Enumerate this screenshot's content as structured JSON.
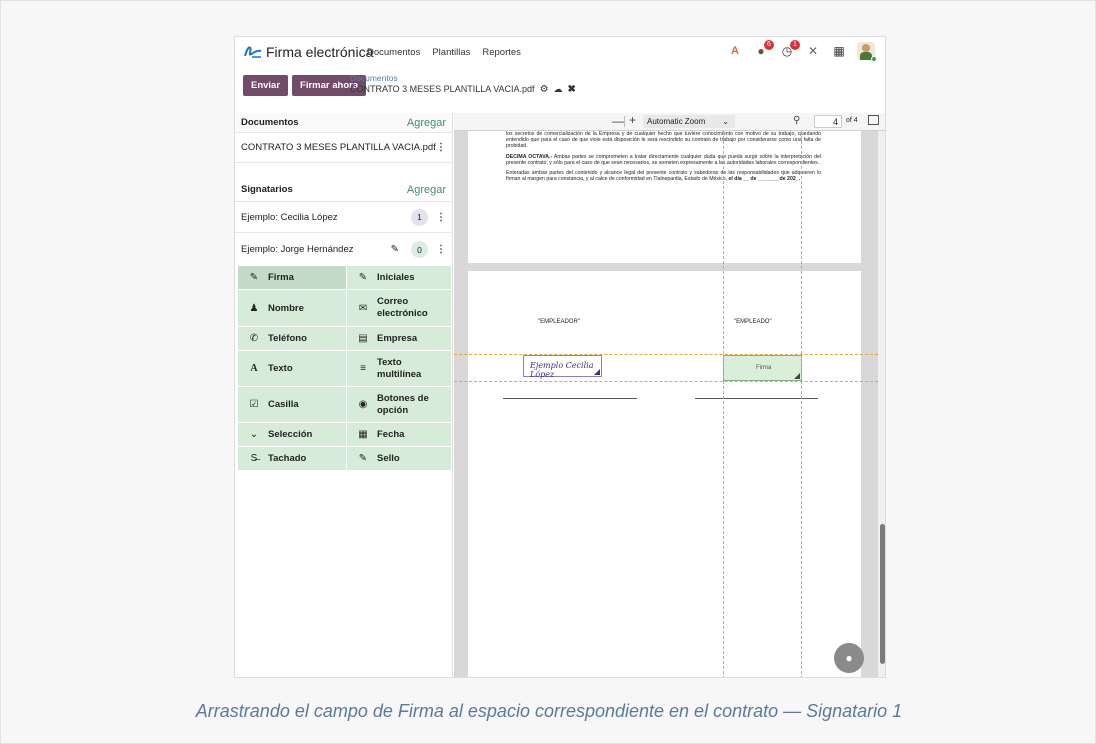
{
  "app": {
    "name": "Firma electrónica",
    "menu": [
      "Documentos",
      "Plantillas",
      "Reportes"
    ],
    "badges": {
      "messages": "6",
      "activities": "1"
    }
  },
  "actions": {
    "send": "Enviar",
    "sign_now": "Firmar ahora"
  },
  "breadcrumb": {
    "parent": "Documentos",
    "current": "CONTRATO 3 MESES PLANTILLA VACIA.pdf"
  },
  "documents": {
    "title": "Documentos",
    "add": "Agregar",
    "items": [
      "CONTRATO 3 MESES PLANTILLA VACIA.pdf"
    ]
  },
  "signers": {
    "title": "Signatarios",
    "add": "Agregar",
    "items": [
      {
        "name": "Ejemplo: Cecilia López",
        "count": "1"
      },
      {
        "name": "Ejemplo: Jorge Hernández",
        "count": "0"
      }
    ]
  },
  "fields": [
    {
      "icon": "✎",
      "label": "Firma"
    },
    {
      "icon": "✎",
      "label": "Iniciales"
    },
    {
      "icon": "♟",
      "label": "Nombre"
    },
    {
      "icon": "✉",
      "label": "Correo electrónico"
    },
    {
      "icon": "✆",
      "label": "Teléfono"
    },
    {
      "icon": "▤",
      "label": "Empresa"
    },
    {
      "icon": "A",
      "label": "Texto"
    },
    {
      "icon": "≡",
      "label": "Texto multilínea"
    },
    {
      "icon": "☑",
      "label": "Casilla"
    },
    {
      "icon": "◉",
      "label": "Botones de opción"
    },
    {
      "icon": "⌄",
      "label": "Selección"
    },
    {
      "icon": "▦",
      "label": "Fecha"
    },
    {
      "icon": "S̶",
      "label": "Tachado"
    },
    {
      "icon": "✎",
      "label": "Sello"
    }
  ],
  "viewer": {
    "zoom": "Automatic Zoom",
    "page": "4",
    "of": "of 4",
    "text1": "los secretos de comercialización de la Empresa y de cualquier hecho que tuviere conocimiento con motivo de su trabajo, quedando entendido que para el caso de que viole está disposición le será rescindido su contrato de trabajo por considerarse como una falta de probidad.",
    "text2_bold": "DECIMA OCTAVA.-",
    "text2": " Ambas partes se comprometen a tratar directamente cualquier duda que pueda surgir sobre la interpretación del presente contrato, y sólo para el caso de que sean necesarios, se someten expresamente a las autoridades laborales correspondientes.",
    "text3": "Enteradas ambas partes del contenido y alcance legal del presente contrato y sabedoras de las responsabilidades que adquieren lo firman al margen para constancia, y al calce de conformidad en Tlalnepantla, Estado de México, ",
    "text3_bold": "el día __ de _______ de 202_.",
    "employer": "\"EMPLEADOR\"",
    "employee": "\"EMPLEADO\"",
    "signature_sample": "Ejemplo Cecilia López",
    "firma_field": "Firma"
  },
  "caption": "Arrastrando el campo de Firma al espacio correspondiente en el contrato — Signatario 1"
}
